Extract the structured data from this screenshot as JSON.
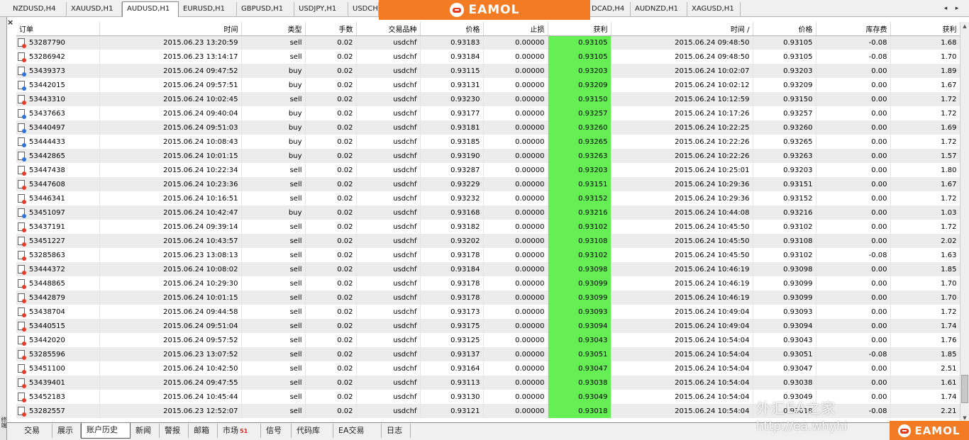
{
  "chart_tabs": [
    {
      "label": "NZDUSD,H4",
      "active": false
    },
    {
      "label": "XAUUSD,H1",
      "active": false
    },
    {
      "label": "AUDUSD,H1",
      "active": true
    },
    {
      "label": "EURUSD,H1",
      "active": false
    },
    {
      "label": "GBPUSD,H1",
      "active": false
    },
    {
      "label": "USDJPY,H1",
      "active": false
    },
    {
      "label": "USDCH",
      "active": false
    },
    {
      "label": "DCAD,H4",
      "active": false
    },
    {
      "label": "AUDNZD,H1",
      "active": false
    },
    {
      "label": "XAGUSD,H1",
      "active": false
    }
  ],
  "tab_scroll": {
    "left": "◂",
    "right": "▸"
  },
  "brand": {
    "logo_text": "EAMOL",
    "accent": "#f27b24"
  },
  "close_button": "×",
  "side_label": "终端",
  "columns": [
    "订单",
    "时间",
    "类型",
    "手数",
    "交易品种",
    "价格",
    "止损",
    "获利",
    "时间   /",
    "价格",
    "库存费",
    "获利"
  ],
  "rows": [
    {
      "order": "53287790",
      "open_time": "2015.06.23 13:20:59",
      "type": "sell",
      "lots": "0.02",
      "symbol": "usdchf",
      "open_price": "0.93183",
      "sl": "0.00000",
      "tp": "0.93105",
      "close_time": "2015.06.24 09:48:50",
      "close_price": "0.93105",
      "swap": "-0.08",
      "profit": "1.68"
    },
    {
      "order": "53286942",
      "open_time": "2015.06.23 13:14:17",
      "type": "sell",
      "lots": "0.02",
      "symbol": "usdchf",
      "open_price": "0.93184",
      "sl": "0.00000",
      "tp": "0.93105",
      "close_time": "2015.06.24 09:48:50",
      "close_price": "0.93105",
      "swap": "-0.08",
      "profit": "1.70"
    },
    {
      "order": "53439373",
      "open_time": "2015.06.24 09:47:52",
      "type": "buy",
      "lots": "0.02",
      "symbol": "usdchf",
      "open_price": "0.93115",
      "sl": "0.00000",
      "tp": "0.93203",
      "close_time": "2015.06.24 10:02:07",
      "close_price": "0.93203",
      "swap": "0.00",
      "profit": "1.89"
    },
    {
      "order": "53442015",
      "open_time": "2015.06.24 09:57:51",
      "type": "buy",
      "lots": "0.02",
      "symbol": "usdchf",
      "open_price": "0.93131",
      "sl": "0.00000",
      "tp": "0.93209",
      "close_time": "2015.06.24 10:02:12",
      "close_price": "0.93209",
      "swap": "0.00",
      "profit": "1.67"
    },
    {
      "order": "53443310",
      "open_time": "2015.06.24 10:02:45",
      "type": "sell",
      "lots": "0.02",
      "symbol": "usdchf",
      "open_price": "0.93230",
      "sl": "0.00000",
      "tp": "0.93150",
      "close_time": "2015.06.24 10:12:59",
      "close_price": "0.93150",
      "swap": "0.00",
      "profit": "1.72"
    },
    {
      "order": "53437663",
      "open_time": "2015.06.24 09:40:04",
      "type": "buy",
      "lots": "0.02",
      "symbol": "usdchf",
      "open_price": "0.93177",
      "sl": "0.00000",
      "tp": "0.93257",
      "close_time": "2015.06.24 10:17:26",
      "close_price": "0.93257",
      "swap": "0.00",
      "profit": "1.72"
    },
    {
      "order": "53440497",
      "open_time": "2015.06.24 09:51:03",
      "type": "buy",
      "lots": "0.02",
      "symbol": "usdchf",
      "open_price": "0.93181",
      "sl": "0.00000",
      "tp": "0.93260",
      "close_time": "2015.06.24 10:22:25",
      "close_price": "0.93260",
      "swap": "0.00",
      "profit": "1.69"
    },
    {
      "order": "53444433",
      "open_time": "2015.06.24 10:08:43",
      "type": "buy",
      "lots": "0.02",
      "symbol": "usdchf",
      "open_price": "0.93185",
      "sl": "0.00000",
      "tp": "0.93265",
      "close_time": "2015.06.24 10:22:26",
      "close_price": "0.93265",
      "swap": "0.00",
      "profit": "1.72"
    },
    {
      "order": "53442865",
      "open_time": "2015.06.24 10:01:15",
      "type": "buy",
      "lots": "0.02",
      "symbol": "usdchf",
      "open_price": "0.93190",
      "sl": "0.00000",
      "tp": "0.93263",
      "close_time": "2015.06.24 10:22:26",
      "close_price": "0.93263",
      "swap": "0.00",
      "profit": "1.57"
    },
    {
      "order": "53447438",
      "open_time": "2015.06.24 10:22:34",
      "type": "sell",
      "lots": "0.02",
      "symbol": "usdchf",
      "open_price": "0.93287",
      "sl": "0.00000",
      "tp": "0.93203",
      "close_time": "2015.06.24 10:25:01",
      "close_price": "0.93203",
      "swap": "0.00",
      "profit": "1.80"
    },
    {
      "order": "53447608",
      "open_time": "2015.06.24 10:23:36",
      "type": "sell",
      "lots": "0.02",
      "symbol": "usdchf",
      "open_price": "0.93229",
      "sl": "0.00000",
      "tp": "0.93151",
      "close_time": "2015.06.24 10:29:36",
      "close_price": "0.93151",
      "swap": "0.00",
      "profit": "1.67"
    },
    {
      "order": "53446341",
      "open_time": "2015.06.24 10:16:51",
      "type": "sell",
      "lots": "0.02",
      "symbol": "usdchf",
      "open_price": "0.93232",
      "sl": "0.00000",
      "tp": "0.93152",
      "close_time": "2015.06.24 10:29:36",
      "close_price": "0.93152",
      "swap": "0.00",
      "profit": "1.72"
    },
    {
      "order": "53451097",
      "open_time": "2015.06.24 10:42:47",
      "type": "buy",
      "lots": "0.02",
      "symbol": "usdchf",
      "open_price": "0.93168",
      "sl": "0.00000",
      "tp": "0.93216",
      "close_time": "2015.06.24 10:44:08",
      "close_price": "0.93216",
      "swap": "0.00",
      "profit": "1.03"
    },
    {
      "order": "53437191",
      "open_time": "2015.06.24 09:39:14",
      "type": "sell",
      "lots": "0.02",
      "symbol": "usdchf",
      "open_price": "0.93182",
      "sl": "0.00000",
      "tp": "0.93102",
      "close_time": "2015.06.24 10:45:50",
      "close_price": "0.93102",
      "swap": "0.00",
      "profit": "1.72"
    },
    {
      "order": "53451227",
      "open_time": "2015.06.24 10:43:57",
      "type": "sell",
      "lots": "0.02",
      "symbol": "usdchf",
      "open_price": "0.93202",
      "sl": "0.00000",
      "tp": "0.93108",
      "close_time": "2015.06.24 10:45:50",
      "close_price": "0.93108",
      "swap": "0.00",
      "profit": "2.02"
    },
    {
      "order": "53285863",
      "open_time": "2015.06.23 13:08:13",
      "type": "sell",
      "lots": "0.02",
      "symbol": "usdchf",
      "open_price": "0.93178",
      "sl": "0.00000",
      "tp": "0.93102",
      "close_time": "2015.06.24 10:45:50",
      "close_price": "0.93102",
      "swap": "-0.08",
      "profit": "1.63"
    },
    {
      "order": "53444372",
      "open_time": "2015.06.24 10:08:02",
      "type": "sell",
      "lots": "0.02",
      "symbol": "usdchf",
      "open_price": "0.93184",
      "sl": "0.00000",
      "tp": "0.93098",
      "close_time": "2015.06.24 10:46:19",
      "close_price": "0.93098",
      "swap": "0.00",
      "profit": "1.85"
    },
    {
      "order": "53448865",
      "open_time": "2015.06.24 10:29:30",
      "type": "sell",
      "lots": "0.02",
      "symbol": "usdchf",
      "open_price": "0.93178",
      "sl": "0.00000",
      "tp": "0.93099",
      "close_time": "2015.06.24 10:46:19",
      "close_price": "0.93099",
      "swap": "0.00",
      "profit": "1.70"
    },
    {
      "order": "53442879",
      "open_time": "2015.06.24 10:01:15",
      "type": "sell",
      "lots": "0.02",
      "symbol": "usdchf",
      "open_price": "0.93178",
      "sl": "0.00000",
      "tp": "0.93099",
      "close_time": "2015.06.24 10:46:19",
      "close_price": "0.93099",
      "swap": "0.00",
      "profit": "1.70"
    },
    {
      "order": "53438704",
      "open_time": "2015.06.24 09:44:58",
      "type": "sell",
      "lots": "0.02",
      "symbol": "usdchf",
      "open_price": "0.93173",
      "sl": "0.00000",
      "tp": "0.93093",
      "close_time": "2015.06.24 10:49:04",
      "close_price": "0.93093",
      "swap": "0.00",
      "profit": "1.72"
    },
    {
      "order": "53440515",
      "open_time": "2015.06.24 09:51:04",
      "type": "sell",
      "lots": "0.02",
      "symbol": "usdchf",
      "open_price": "0.93175",
      "sl": "0.00000",
      "tp": "0.93094",
      "close_time": "2015.06.24 10:49:04",
      "close_price": "0.93094",
      "swap": "0.00",
      "profit": "1.74"
    },
    {
      "order": "53442020",
      "open_time": "2015.06.24 09:57:52",
      "type": "sell",
      "lots": "0.02",
      "symbol": "usdchf",
      "open_price": "0.93125",
      "sl": "0.00000",
      "tp": "0.93043",
      "close_time": "2015.06.24 10:54:04",
      "close_price": "0.93043",
      "swap": "0.00",
      "profit": "1.76"
    },
    {
      "order": "53285596",
      "open_time": "2015.06.23 13:07:52",
      "type": "sell",
      "lots": "0.02",
      "symbol": "usdchf",
      "open_price": "0.93137",
      "sl": "0.00000",
      "tp": "0.93051",
      "close_time": "2015.06.24 10:54:04",
      "close_price": "0.93051",
      "swap": "-0.08",
      "profit": "1.85"
    },
    {
      "order": "53451100",
      "open_time": "2015.06.24 10:42:50",
      "type": "sell",
      "lots": "0.02",
      "symbol": "usdchf",
      "open_price": "0.93164",
      "sl": "0.00000",
      "tp": "0.93047",
      "close_time": "2015.06.24 10:54:04",
      "close_price": "0.93047",
      "swap": "0.00",
      "profit": "2.51"
    },
    {
      "order": "53439401",
      "open_time": "2015.06.24 09:47:55",
      "type": "sell",
      "lots": "0.02",
      "symbol": "usdchf",
      "open_price": "0.93113",
      "sl": "0.00000",
      "tp": "0.93038",
      "close_time": "2015.06.24 10:54:04",
      "close_price": "0.93038",
      "swap": "0.00",
      "profit": "1.61"
    },
    {
      "order": "53452183",
      "open_time": "2015.06.24 10:45:44",
      "type": "sell",
      "lots": "0.02",
      "symbol": "usdchf",
      "open_price": "0.93130",
      "sl": "0.00000",
      "tp": "0.93049",
      "close_time": "2015.06.24 10:54:04",
      "close_price": "0.93049",
      "swap": "0.00",
      "profit": "1.74"
    },
    {
      "order": "53282557",
      "open_time": "2015.06.23 12:52:07",
      "type": "sell",
      "lots": "0.02",
      "symbol": "usdchf",
      "open_price": "0.93121",
      "sl": "0.00000",
      "tp": "0.93018",
      "close_time": "2015.06.24 10:54:04",
      "close_price": "0.93018",
      "swap": "-0.08",
      "profit": "2.21"
    }
  ],
  "highlight_color": "#66ee55",
  "terminal_tabs": [
    {
      "label": "交易",
      "active": false,
      "badge": ""
    },
    {
      "label": "展示",
      "active": false,
      "badge": ""
    },
    {
      "label": "账户历史",
      "active": true,
      "badge": ""
    },
    {
      "label": "新闻",
      "active": false,
      "badge": ""
    },
    {
      "label": "警报",
      "active": false,
      "badge": ""
    },
    {
      "label": "邮箱",
      "active": false,
      "badge": ""
    },
    {
      "label": "市场",
      "active": false,
      "badge": "51"
    },
    {
      "label": "信号",
      "active": false,
      "badge": ""
    },
    {
      "label": "代码库",
      "active": false,
      "badge": ""
    },
    {
      "label": "EA交易",
      "active": false,
      "badge": ""
    },
    {
      "label": "日志",
      "active": false,
      "badge": ""
    }
  ],
  "watermark": {
    "text": "外汇EA之家",
    "url": "http://ea.whyhi"
  }
}
